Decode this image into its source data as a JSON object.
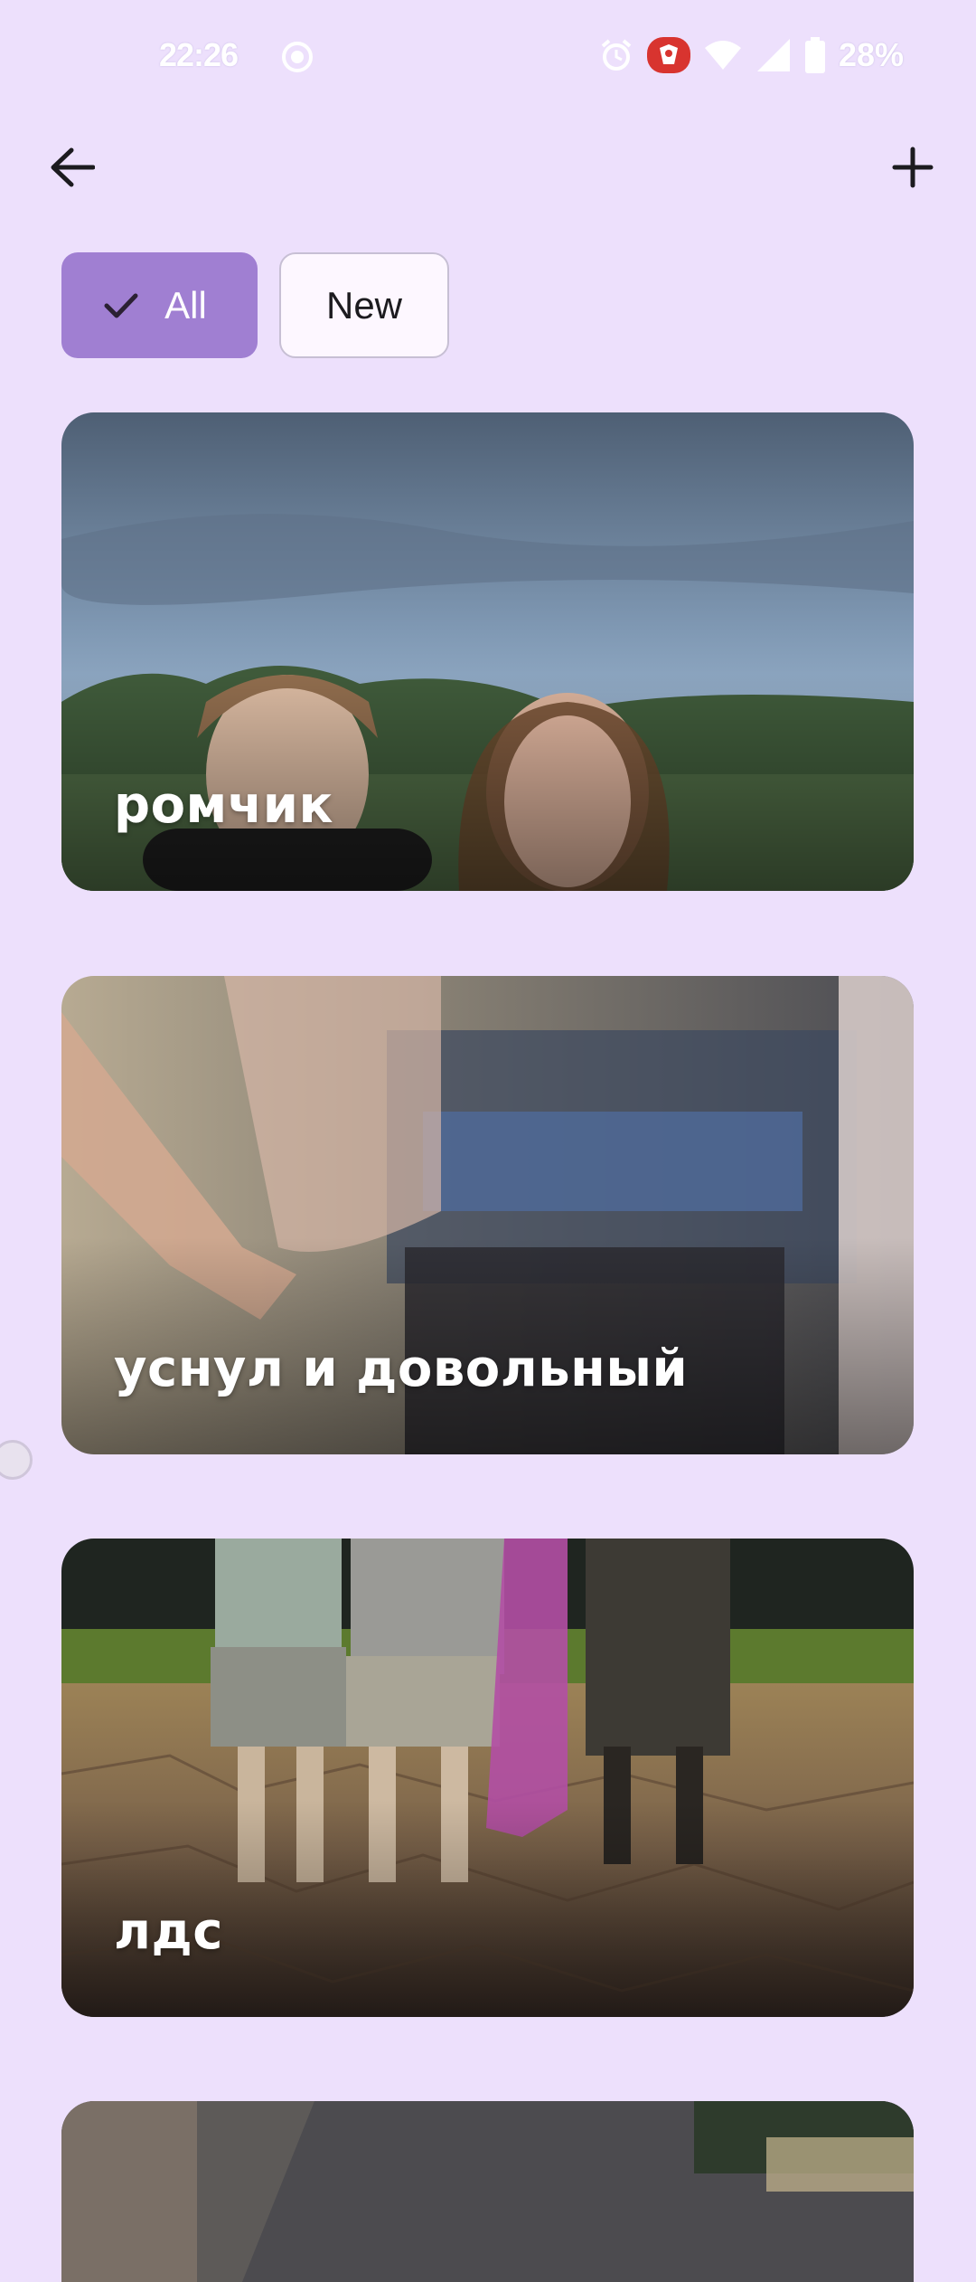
{
  "status_bar": {
    "time": "22:26",
    "battery": "28%",
    "icons": [
      "screen-record-icon",
      "alarm-icon",
      "notification-app-icon",
      "wifi-icon",
      "signal-icon",
      "battery-icon"
    ]
  },
  "app_bar": {
    "back_icon": "arrow-back-icon",
    "add_icon": "plus-icon"
  },
  "filters": {
    "chips": [
      {
        "label": "All",
        "selected": true,
        "icon": "check-icon"
      },
      {
        "label": "New",
        "selected": false
      }
    ]
  },
  "cards": [
    {
      "title": "ромчик"
    },
    {
      "title": "уснул и довольный"
    },
    {
      "title": "лдс"
    },
    {
      "title": ""
    }
  ],
  "colors": {
    "background": "#ede0fc",
    "chip_selected": "#a07fd2",
    "chip_unselected": "#fdf7ff"
  }
}
